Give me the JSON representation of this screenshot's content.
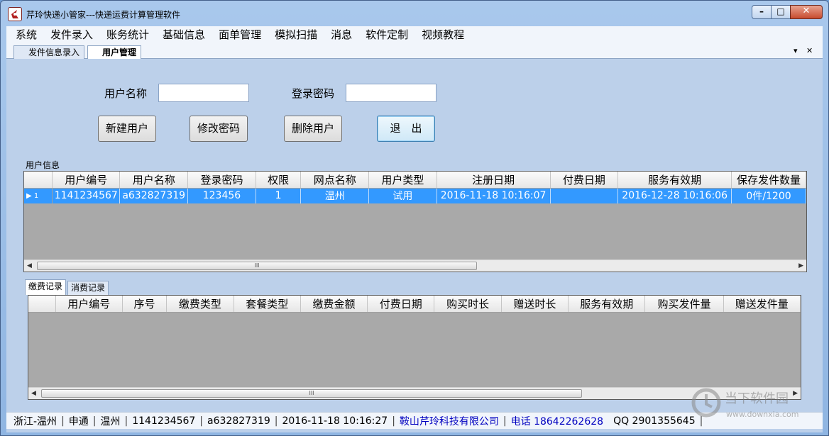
{
  "window": {
    "title": "芹玲快递小管家---快递运费计算管理软件",
    "minimize": "–",
    "maximize": "□",
    "close": "✕"
  },
  "menu": [
    "系统",
    "发件录入",
    "账务统计",
    "基础信息",
    "面单管理",
    "模拟扫描",
    "消息",
    "软件定制",
    "视频教程"
  ],
  "doc_tabs": [
    {
      "label": "发件信息录入",
      "active": false
    },
    {
      "label": "用户管理",
      "active": true
    }
  ],
  "tab_controls": {
    "dropdown": "▾",
    "close": "✕"
  },
  "form": {
    "username_label": "用户名称",
    "username_value": "",
    "password_label": "登录密码",
    "password_value": "",
    "buttons": {
      "new_user": "新建用户",
      "change_password": "修改密码",
      "delete_user": "删除用户",
      "exit": "退　出"
    }
  },
  "user_grid": {
    "group_title": "用户信息",
    "columns": [
      "用户编号",
      "用户名称",
      "登录密码",
      "权限",
      "网点名称",
      "用户类型",
      "注册日期",
      "付费日期",
      "服务有效期",
      "保存发件数量"
    ],
    "rows": [
      {
        "row_marker": "▶ 1",
        "cells": [
          "1141234567",
          "a632827319",
          "123456",
          "1",
          "温州",
          "试用",
          "2016-11-18 10:16:07",
          "",
          "2016-12-28 10:16:06",
          "0件/1200"
        ]
      }
    ],
    "scroll_grip": "III"
  },
  "record_tabs": [
    {
      "label": "缴费记录",
      "active": true
    },
    {
      "label": "消费记录",
      "active": false
    }
  ],
  "payment_grid": {
    "columns": [
      "用户编号",
      "序号",
      "缴费类型",
      "套餐类型",
      "缴费金额",
      "付费日期",
      "购买时长",
      "赠送时长",
      "服务有效期",
      "购买发件量",
      "赠送发件量"
    ],
    "scroll_grip": "III"
  },
  "status": {
    "region": "浙江-温州",
    "courier": "申通",
    "city": "温州",
    "user_id": "1141234567",
    "user_name": "a632827319",
    "login_time": "2016-11-18 10:16:27",
    "company": "鞍山芹玲科技有限公司",
    "phone": "电话 18642262628",
    "qq": "QQ 2901355645"
  },
  "watermark": {
    "text": "当下软件园",
    "url": "www.downxia.com"
  },
  "colors": {
    "selection": "#3399ff",
    "link_blue": "#0000c0",
    "panel": "#bcd0ea"
  }
}
